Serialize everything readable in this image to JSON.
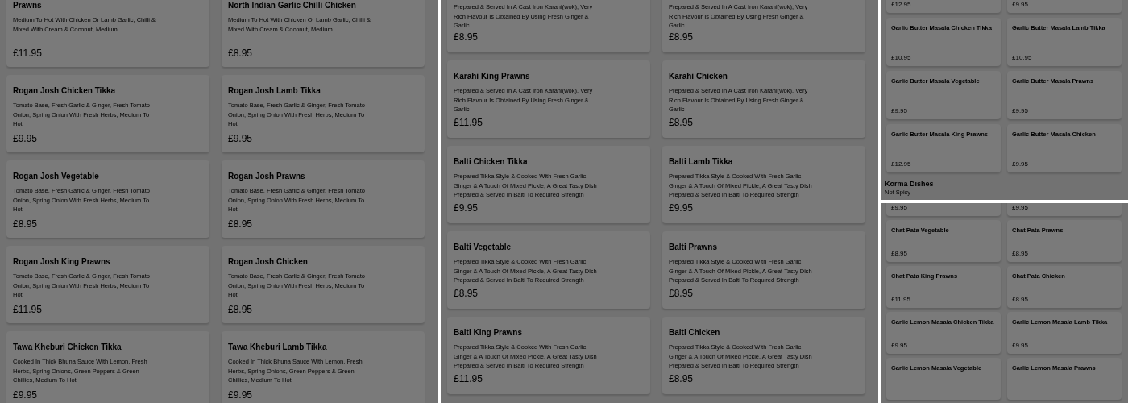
{
  "columns": [
    {
      "panels": [
        {
          "items": [
            {
              "kind": "card",
              "title": "Prawns",
              "description": "Medium To Hot With Chicken Or Lamb Garlic, Chilli & Mixed With Cream & Coconut, Medium",
              "price": "£11.95"
            },
            {
              "kind": "card",
              "title": "North Indian Garlic Chilli Chicken",
              "description": "Medium To Hot With Chicken Or Lamb Garlic, Chilli & Mixed With Cream & Coconut, Medium",
              "price": "£8.95"
            },
            {
              "kind": "card",
              "title": "Rogan Josh Chicken Tikka",
              "description": "Tomato Base, Fresh Garlic & Ginger, Fresh Tomato Onion, Spring Onion With Fresh Herbs, Medium To Hot",
              "price": "£9.95"
            },
            {
              "kind": "card",
              "title": "Rogan Josh Lamb Tikka",
              "description": "Tomato Base, Fresh Garlic & Ginger, Fresh Tomato Onion, Spring Onion With Fresh Herbs, Medium To Hot",
              "price": "£9.95"
            },
            {
              "kind": "card",
              "title": "Rogan Josh Vegetable",
              "description": "Tomato Base, Fresh Garlic & Ginger, Fresh Tomato Onion, Spring Onion With Fresh Herbs, Medium To Hot",
              "price": "£8.95"
            },
            {
              "kind": "card",
              "title": "Rogan Josh Prawns",
              "description": "Tomato Base, Fresh Garlic & Ginger, Fresh Tomato Onion, Spring Onion With Fresh Herbs, Medium To Hot",
              "price": "£8.95"
            },
            {
              "kind": "card",
              "title": "Rogan Josh King Prawns",
              "description": "Tomato Base, Fresh Garlic & Ginger, Fresh Tomato Onion, Spring Onion With Fresh Herbs, Medium To Hot",
              "price": "£11.95"
            },
            {
              "kind": "card",
              "title": "Rogan Josh Chicken",
              "description": "Tomato Base, Fresh Garlic & Ginger, Fresh Tomato Onion, Spring Onion With Fresh Herbs, Medium To Hot",
              "price": "£8.95"
            },
            {
              "kind": "card",
              "title": "Tawa Kheburi Chicken Tikka",
              "description": "Cooked In Thick Bhuna Sauce With Lemon, Fresh Herbs, Spring Onions, Green Peppers & Green Chillies, Medium To Hot",
              "price": "£9.95"
            },
            {
              "kind": "card",
              "title": "Tawa Kheburi Lamb Tikka",
              "description": "Cooked In Thick Bhuna Sauce With Lemon, Fresh Herbs, Spring Onions, Green Peppers & Green Chillies, Medium To Hot",
              "price": "£9.95"
            }
          ]
        }
      ]
    },
    {
      "panels": [
        {
          "items": [
            {
              "kind": "card",
              "description": "Prepared & Served In A Cast Iron Karahi(wok), Very Rich Flavour Is Obtained By Using Fresh Ginger & Garlic",
              "price": "£8.95"
            },
            {
              "kind": "card",
              "description": "Prepared & Served In A Cast Iron Karahi(wok), Very Rich Flavour Is Obtained By Using Fresh Ginger & Garlic",
              "price": "£8.95"
            },
            {
              "kind": "card",
              "title": "Karahi King Prawns",
              "description": "Prepared & Served In A Cast Iron Karahi(wok), Very Rich Flavour Is Obtained By Using Fresh Ginger & Garlic",
              "price": "£11.95"
            },
            {
              "kind": "card",
              "title": "Karahi Chicken",
              "description": "Prepared & Served In A Cast Iron Karahi(wok), Very Rich Flavour Is Obtained By Using Fresh Ginger & Garlic",
              "price": "£8.95"
            },
            {
              "kind": "card",
              "title": "Balti Chicken Tikka",
              "description": "Prepared Tikka Style & Cooked With Fresh Garlic, Ginger & A Touch Of Mixed Pickle, A Great Tasty Dish Prepared & Served In Balti To Required Strength",
              "price": "£9.95"
            },
            {
              "kind": "card",
              "title": "Balti Lamb Tikka",
              "description": "Prepared Tikka Style & Cooked With Fresh Garlic, Ginger & A Touch Of Mixed Pickle, A Great Tasty Dish Prepared & Served In Balti To Required Strength",
              "price": "£9.95"
            },
            {
              "kind": "card",
              "title": "Balti Vegetable",
              "description": "Prepared Tikka Style & Cooked With Fresh Garlic, Ginger & A Touch Of Mixed Pickle, A Great Tasty Dish Prepared & Served In Balti To Required Strength",
              "price": "£8.95"
            },
            {
              "kind": "card",
              "title": "Balti Prawns",
              "description": "Prepared Tikka Style & Cooked With Fresh Garlic, Ginger & A Touch Of Mixed Pickle, A Great Tasty Dish Prepared & Served In Balti To Required Strength",
              "price": "£8.95"
            },
            {
              "kind": "card",
              "title": "Balti King Prawns",
              "description": "Prepared Tikka Style & Cooked With Fresh Garlic, Ginger & A Touch Of Mixed Pickle, A Great Tasty Dish Prepared & Served In Balti To Required Strength",
              "price": "£11.95"
            },
            {
              "kind": "card",
              "title": "Balti Chicken",
              "description": "Prepared Tikka Style & Cooked With Fresh Garlic, Ginger & A Touch Of Mixed Pickle, A Great Tasty Dish Prepared & Served In Balti To Required Strength",
              "price": "£8.95"
            }
          ]
        }
      ]
    },
    {
      "panels": [
        {
          "items": [
            {
              "kind": "card",
              "price": "£12.95"
            },
            {
              "kind": "card",
              "price": "£9.95"
            },
            {
              "kind": "card",
              "title": "Garlic Butter Masala Chicken Tikka",
              "price": "£10.95"
            },
            {
              "kind": "card",
              "title": "Garlic Butter Masala Lamb Tikka",
              "price": "£10.95"
            },
            {
              "kind": "card",
              "title": "Garlic Butter Masala Vegetable",
              "price": "£9.95"
            },
            {
              "kind": "card",
              "title": "Garlic Butter Masala Prawns",
              "price": "£9.95"
            },
            {
              "kind": "card",
              "title": "Garlic Butter Masala King Prawns",
              "price": "£12.95"
            },
            {
              "kind": "card",
              "title": "Garlic Butter Masala Chicken",
              "price": "£9.95"
            },
            {
              "kind": "heading",
              "title": "Korma Dishes",
              "subtitle": "Not Spicy"
            }
          ]
        },
        {
          "items": [
            {
              "kind": "card",
              "price": "£9.95"
            },
            {
              "kind": "card",
              "price": "£9.95"
            },
            {
              "kind": "card",
              "title": "Chat Pata Vegetable",
              "price": "£8.95"
            },
            {
              "kind": "card",
              "title": "Chat Pata Prawns",
              "price": "£8.95"
            },
            {
              "kind": "card",
              "title": "Chat Pata King Prawns",
              "price": "£11.95"
            },
            {
              "kind": "card",
              "title": "Chat Pata Chicken",
              "price": "£8.95"
            },
            {
              "kind": "card",
              "title": "Garlic Lemon Masala Chicken Tikka",
              "price": "£9.95"
            },
            {
              "kind": "card",
              "title": "Garlic Lemon Masala Lamb Tikka",
              "price": "£9.95"
            },
            {
              "kind": "card",
              "title": "Garlic Lemon Masala Vegetable"
            },
            {
              "kind": "card",
              "title": "Garlic Lemon Masala Prawns"
            }
          ]
        }
      ]
    }
  ]
}
